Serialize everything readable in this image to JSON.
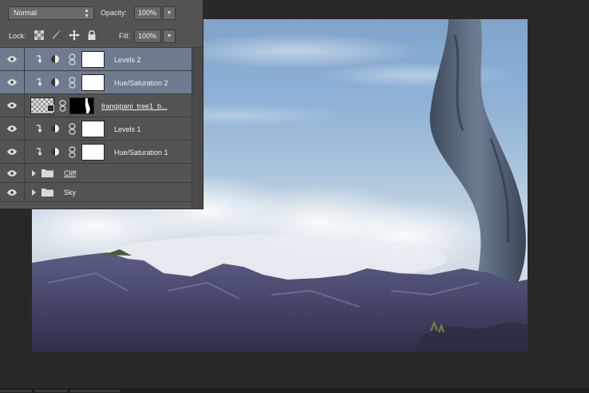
{
  "options": {
    "blend_mode": "Normal",
    "opacity_label": "Opacity:",
    "opacity_value": "100%",
    "lock_label": "Lock:",
    "fill_label": "Fill:",
    "fill_value": "100%"
  },
  "layers": [
    {
      "name": "Levels 2",
      "kind": "adjustment",
      "selected": true,
      "clipped": true
    },
    {
      "name": "Hue/Saturation 2",
      "kind": "adjustment",
      "selected": true,
      "clipped": true
    },
    {
      "name": "frangipani_tree1_b...",
      "kind": "image-with-mask",
      "selected": false
    },
    {
      "name": "Levels 1",
      "kind": "adjustment",
      "selected": false,
      "clipped": true
    },
    {
      "name": "Hue/Saturation 1",
      "kind": "adjustment",
      "selected": false,
      "clipped": true
    },
    {
      "name": "Cliff",
      "kind": "group",
      "selected": false
    },
    {
      "name": "Sky",
      "kind": "group",
      "selected": false
    }
  ],
  "icons": {
    "visibility": "eye-icon",
    "clip": "clipping-arrow-icon",
    "adjustment": "adjustment-circle-icon",
    "link": "chain-link-icon",
    "folder": "folder-icon",
    "expand": "expand-triangle-icon",
    "lock_transparent": "lock-transparent-pixels-icon",
    "lock_image": "lock-image-pixels-icon",
    "lock_position": "lock-position-icon",
    "lock_all": "lock-all-icon"
  },
  "colors": {
    "panel": "#535353",
    "selected_row": "#6f7c8f",
    "workspace": "#282828"
  }
}
